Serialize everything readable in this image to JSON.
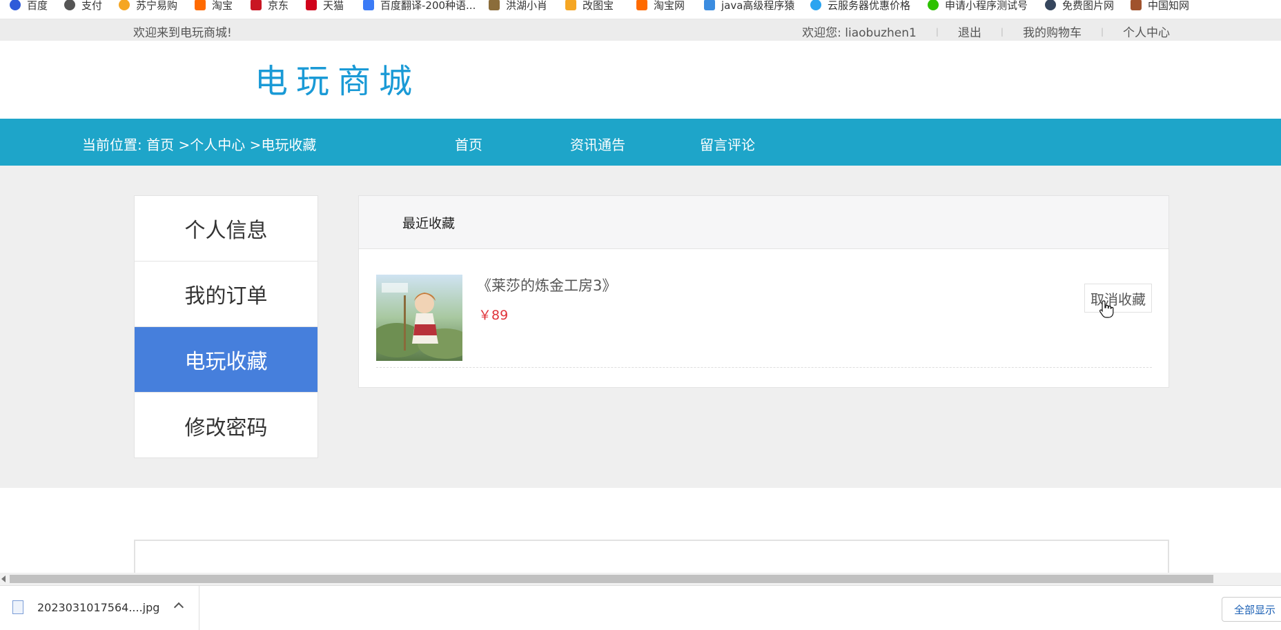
{
  "bookmarks": [
    {
      "label": "百度",
      "icon": "baidu-icon",
      "color": "#2f5bd9"
    },
    {
      "label": "支付",
      "icon": "globe-icon",
      "color": "#555555"
    },
    {
      "label": "苏宁易购",
      "icon": "suning-icon",
      "color": "#f5a623"
    },
    {
      "label": "淘宝",
      "icon": "taobao-icon",
      "color": "#ff6a00"
    },
    {
      "label": "京东",
      "icon": "jd-icon",
      "color": "#c91623"
    },
    {
      "label": "天猫",
      "icon": "tmall-icon",
      "color": "#d0021b"
    },
    {
      "label": "百度翻译-200种语...",
      "icon": "translate-icon",
      "color": "#3b7bf6"
    },
    {
      "label": "洪湖小肖",
      "icon": "feather-icon",
      "color": "#8b6d3b"
    },
    {
      "label": "改图宝",
      "icon": "gaitubao-icon",
      "color": "#f5a623"
    },
    {
      "label": "淘宝网",
      "icon": "taobao-icon",
      "color": "#ff6a00"
    },
    {
      "label": "java高级程序猿",
      "icon": "bilibili-icon",
      "color": "#3b8ce0"
    },
    {
      "label": "云服务器优惠价格",
      "icon": "cloud-icon",
      "color": "#2aa4f0"
    },
    {
      "label": "申请小程序测试号",
      "icon": "wechat-icon",
      "color": "#2dc100"
    },
    {
      "label": "免费图片网",
      "icon": "t-icon",
      "color": "#36465d"
    },
    {
      "label": "中国知网",
      "icon": "cnki-icon",
      "color": "#a0522d"
    }
  ],
  "topbar": {
    "welcome": "欢迎来到电玩商城!",
    "user_greeting": "欢迎您:  liaobuzhen1",
    "logout": "退出",
    "cart": "我的购物车",
    "profile": "个人中心",
    "separator": "|"
  },
  "header": {
    "logo_text": "电玩商城"
  },
  "nav": {
    "breadcrumb": "当前位置: 首页 >个人中心 >电玩收藏",
    "links": [
      "首页",
      "资讯通告",
      "留言评论"
    ]
  },
  "sidebar": {
    "items": [
      "个人信息",
      "我的订单",
      "电玩收藏",
      "修改密码"
    ],
    "active_index": 2
  },
  "favorites": {
    "heading": "最近收藏",
    "items": [
      {
        "title": "《莱莎的炼金工房3》",
        "price": "￥89",
        "action": "取消收藏"
      }
    ]
  },
  "downloads": {
    "file": "2023031017564....jpg",
    "show_all": "全部显示"
  },
  "colors": {
    "nav_bg": "#1ea5c9",
    "active_sidebar": "#467fdc",
    "price": "#e0343a",
    "logo": "#1a9ad6"
  }
}
